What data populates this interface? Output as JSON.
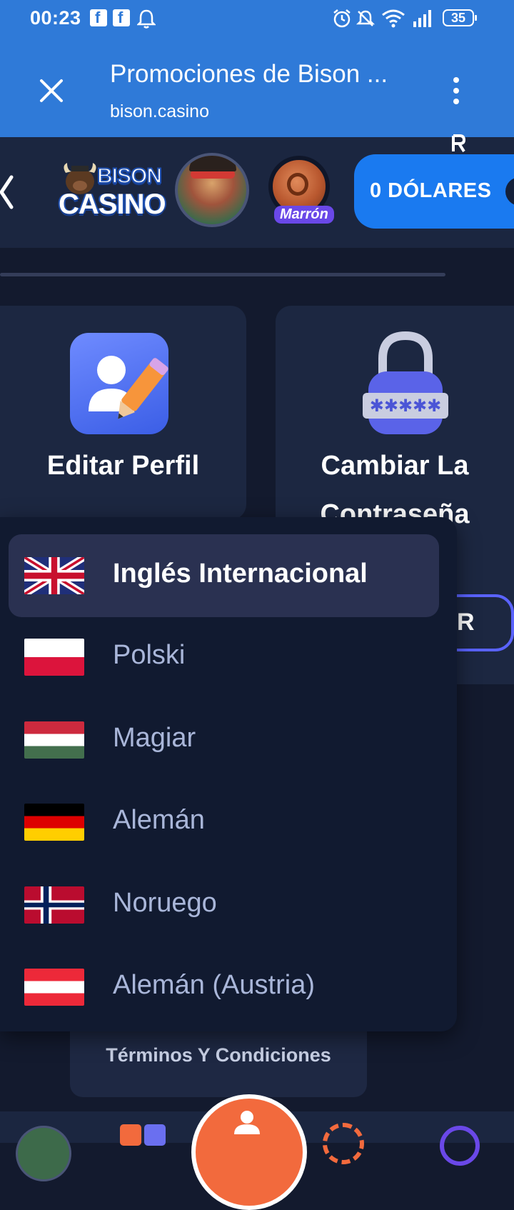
{
  "status_bar": {
    "time": "00:23",
    "battery": "35",
    "icons": [
      "facebook-icon",
      "facebook-icon",
      "notification-bell-icon",
      "alarm-icon",
      "mute-icon",
      "wifi-icon",
      "signal-icon",
      "battery-icon"
    ]
  },
  "browser": {
    "page_title": "Promociones de Bison ...",
    "url": "bison.casino"
  },
  "site_header": {
    "logo_line1": "BISON",
    "logo_line2": "CASINO",
    "rank_label": "Marrón",
    "balance_label": "0 DÓLARES"
  },
  "cards": {
    "edit_profile": "Editar Perfil",
    "change_password_line1": "Cambiar La",
    "change_password_line2": "Contraseña",
    "partial_button": "R"
  },
  "language_menu": {
    "items": [
      {
        "label": "Inglés Internacional",
        "flag": "uk-flag-icon",
        "selected": true
      },
      {
        "label": "Polski",
        "flag": "poland-flag-icon",
        "selected": false
      },
      {
        "label": "Magiar",
        "flag": "hungary-flag-icon",
        "selected": false
      },
      {
        "label": "Alemán",
        "flag": "germany-flag-icon",
        "selected": false
      },
      {
        "label": "Noruego",
        "flag": "norway-flag-icon",
        "selected": false
      },
      {
        "label": "Alemán (Austria)",
        "flag": "austria-flag-icon",
        "selected": false
      }
    ]
  },
  "footer": {
    "terms_label": "Términos Y Condiciones"
  },
  "colors": {
    "browser_bar": "#2f7ad8",
    "background": "#131a2e",
    "balance_button": "#1a7af0",
    "fab": "#f26a3d",
    "rank_badge": "#6a48e8"
  }
}
